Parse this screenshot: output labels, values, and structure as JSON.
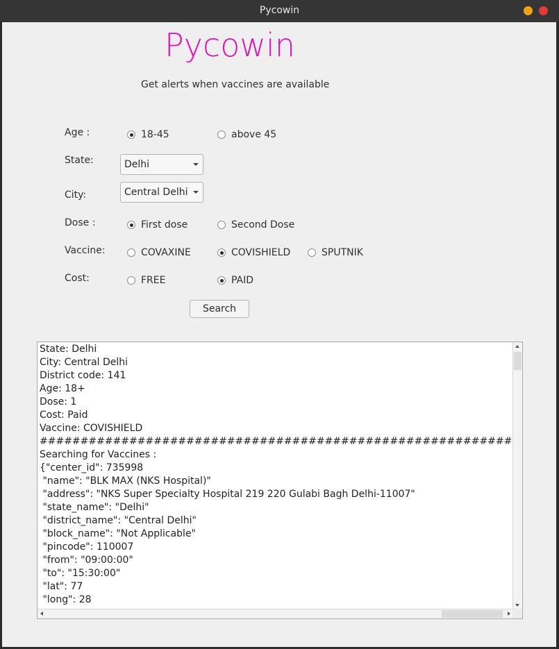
{
  "window": {
    "title": "Pycowin"
  },
  "app": {
    "title": "Pycowin",
    "subtitle": "Get alerts when vaccines are available"
  },
  "form": {
    "age": {
      "label": "Age :",
      "options": [
        "18-45",
        "above 45"
      ],
      "selected": "18-45"
    },
    "state": {
      "label": "State:",
      "value": "Delhi"
    },
    "city": {
      "label": "City:",
      "value": "Central Delhi"
    },
    "dose": {
      "label": "Dose :",
      "options": [
        "First dose",
        "Second Dose"
      ],
      "selected": "First dose"
    },
    "vaccine": {
      "label": "Vaccine:",
      "options": [
        "COVAXINE",
        "COVISHIELD",
        "SPUTNIK"
      ],
      "selected": "COVISHIELD"
    },
    "cost": {
      "label": "Cost:",
      "options": [
        "FREE",
        "PAID"
      ],
      "selected": "PAID"
    },
    "search_label": "Search"
  },
  "output": {
    "lines": [
      "State: Delhi",
      "City: Central Delhi",
      "District code: 141",
      "Age: 18+",
      "Dose: 1",
      "Cost: Paid",
      "Vaccine: COVISHIELD",
      "##########################################################",
      "Searching for Vaccines :",
      "{\"center_id\": 735998",
      " \"name\": \"BLK MAX (NKS Hospital)\"",
      " \"address\": \"NKS Super Specialty Hospital 219 220 Gulabi Bagh Delhi-11007\"",
      " \"state_name\": \"Delhi\"",
      " \"district_name\": \"Central Delhi\"",
      " \"block_name\": \"Not Applicable\"",
      " \"pincode\": 110007",
      " \"from\": \"09:00:00\"",
      " \"to\": \"15:30:00\"",
      " \"lat\": 77",
      " \"long\": 28"
    ]
  },
  "colors": {
    "accent": "#e214b7",
    "minimize": "#f0a30a",
    "close": "#e53935"
  }
}
